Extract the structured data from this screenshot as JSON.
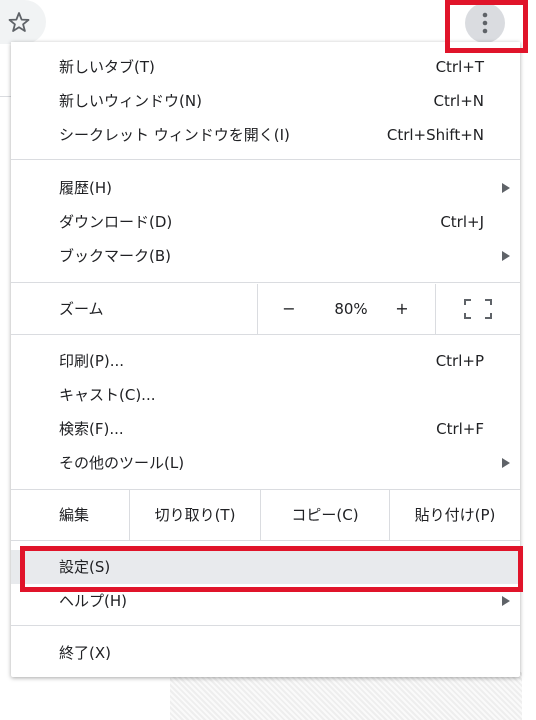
{
  "toolbar": {
    "bookmark_icon": "star-outline-icon",
    "menu_icon": "three-dots-vertical-icon"
  },
  "menu": {
    "group1": [
      {
        "label": "新しいタブ(T)",
        "shortcut": "Ctrl+T"
      },
      {
        "label": "新しいウィンドウ(N)",
        "shortcut": "Ctrl+N"
      },
      {
        "label": "シークレット ウィンドウを開く(I)",
        "shortcut": "Ctrl+Shift+N"
      }
    ],
    "group2": [
      {
        "label": "履歴(H)",
        "submenu": true
      },
      {
        "label": "ダウンロード(D)",
        "shortcut": "Ctrl+J"
      },
      {
        "label": "ブックマーク(B)",
        "submenu": true
      }
    ],
    "zoom": {
      "label": "ズーム",
      "minus": "−",
      "value": "80%",
      "plus": "+",
      "fullscreen_icon": "fullscreen-icon"
    },
    "group3": [
      {
        "label": "印刷(P)...",
        "shortcut": "Ctrl+P"
      },
      {
        "label": "キャスト(C)..."
      },
      {
        "label": "検索(F)...",
        "shortcut": "Ctrl+F"
      },
      {
        "label": "その他のツール(L)",
        "submenu": true
      }
    ],
    "edit": {
      "label": "編集",
      "cut": "切り取り(T)",
      "copy": "コピー(C)",
      "paste": "貼り付け(P)"
    },
    "group4": [
      {
        "label": "設定(S)",
        "highlighted": true
      },
      {
        "label": "ヘルプ(H)",
        "submenu": true
      }
    ],
    "exit": {
      "label": "終了(X)"
    }
  },
  "colors": {
    "highlight_border": "#e0142a",
    "hover_background": "#e8eaed",
    "separator": "#dadce0"
  }
}
